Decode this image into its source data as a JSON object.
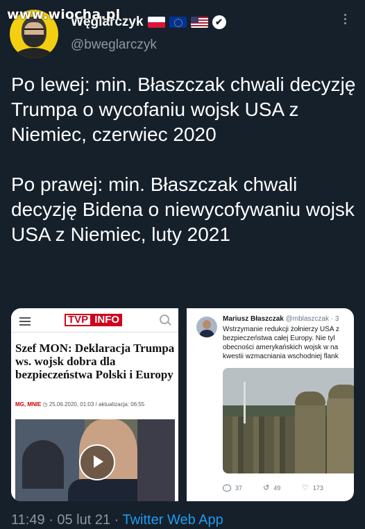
{
  "watermark": "www.wiocha.pl",
  "header": {
    "display_name": "Węglarczyk",
    "handle": "@bweglarczyk",
    "verified_glyph": "✔"
  },
  "tweet": {
    "paragraphs": [
      "Po lewej: min. Błaszczak chwali decyzję Trumpa o wycofaniu wojsk USA z Niemiec, czerwiec 2020",
      "Po prawej: min. Błaszczak chwali decyzję Bidena o niewycofywaniu wojsk USA z Niemiec, luty 2021"
    ]
  },
  "left_card": {
    "logo_a": "TVP",
    "logo_b": "INFO",
    "headline": "Szef MON: Deklaracja Trumpa ws. wojsk dobra dla bezpieczeństwa Polski i Europy",
    "author": "MG, MNIE",
    "date": "25.06.2020, 01:03",
    "updated": "/ aktualizacja: 06:55"
  },
  "right_card": {
    "name": "Mariusz Błaszczak",
    "handle": "@mblaszczak · 3",
    "lines": [
      "Wstrzymanie redukcji żołnierzy USA z",
      "bezpieczeństwa całej Europy. Nie tyl",
      "obecności amerykańskich wojsk w na",
      "kwestii wzmacniania wschodniej flank"
    ],
    "replies": "37",
    "retweets": "49",
    "likes": "173"
  },
  "footer": {
    "time_date": "11:49 · 05 lut 21 · ",
    "source": "Twitter Web App"
  },
  "colors": {
    "background": "#15202b",
    "link": "#1d9bf0",
    "secondary_text": "#8b98a5",
    "tvp_red": "#d0021b"
  }
}
